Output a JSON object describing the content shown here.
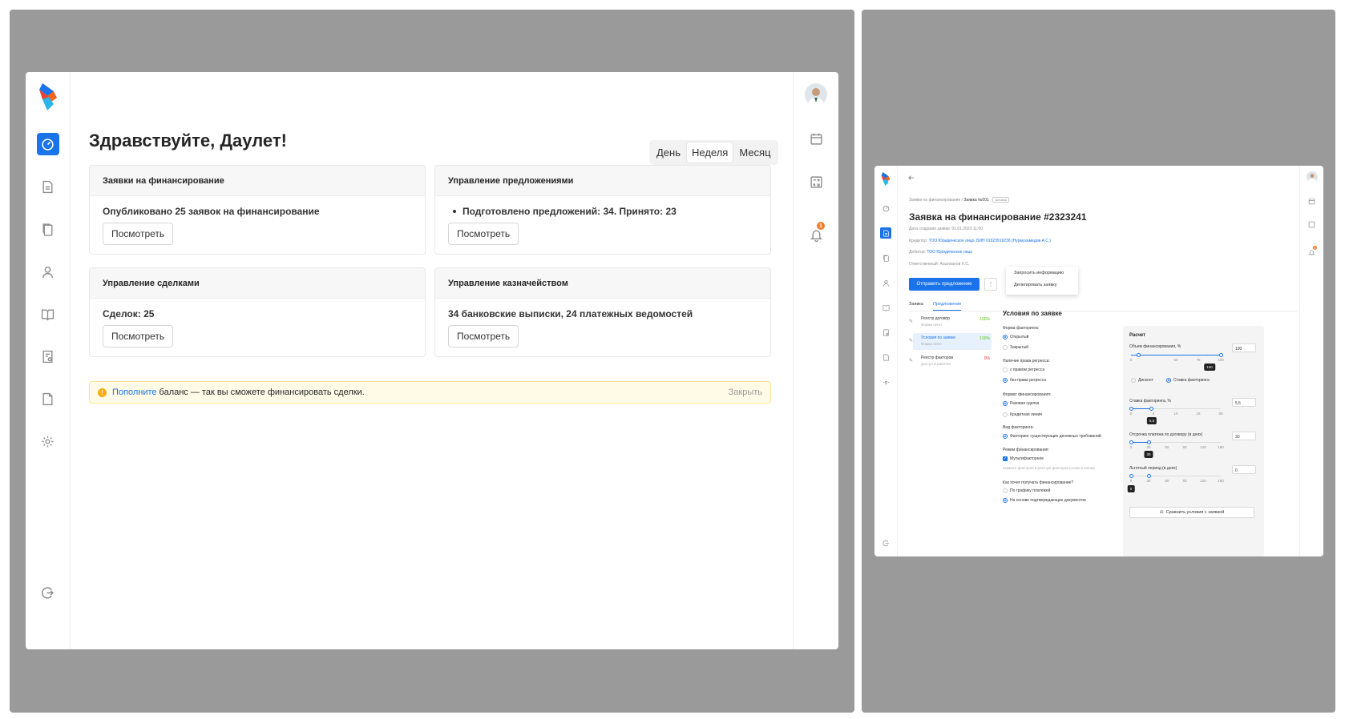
{
  "dashboard": {
    "greeting": "Здравствуйте, Даулет!",
    "period_tabs": [
      "День",
      "Неделя",
      "Месяц"
    ],
    "period_selected": "Неделя",
    "cards": [
      {
        "title": "Заявки на финансирование",
        "text": "Опубликовано 25 заявок на финансирование",
        "button": "Посмотреть"
      },
      {
        "title": "Управление предложениями",
        "text": "Подготовлено предложений: 34. Принято: 23",
        "button": "Посмотреть"
      },
      {
        "title": "Управление сделками",
        "text": "Сделок: 25",
        "button": "Посмотреть"
      },
      {
        "title": "Управление казначейством",
        "text": "34 банковские выписки, 24 платежных ведомостей",
        "button": "Посмотреть"
      }
    ],
    "alert": {
      "link": "Пополните",
      "text": "баланс — так вы сможете финансировать сделки.",
      "close": "Закрыть"
    },
    "notification_count": "1"
  },
  "application": {
    "breadcrumb": [
      "Заявки на финансирование",
      "Заявка №001"
    ],
    "status": "Активна",
    "title": "Заявка на финансирование #2323241",
    "created_label": "Дата создания заявки: 01.01.2023 11:00",
    "creditor_label": "Кредитор:",
    "creditor_value": "ТОО Юридическое лицо, БИН 01923919236 (Нурмухамедов А.С.)",
    "debtor_label": "Дебитор:",
    "debtor_value": "ТОО Юридическое лицо",
    "responsible": "Ответственный: Асылханов Х.С.",
    "send_button": "Отправить предложение",
    "more_button": "⋮",
    "menu": [
      "Запросить информацию",
      "Делегировать заявку"
    ],
    "tabs": [
      "Заявка",
      "Предложение"
    ],
    "tab_selected": "Предложение",
    "steps": [
      {
        "name": "Реестр договор",
        "sub": "Форма агент",
        "pct": "100%",
        "color": "#52c41a"
      },
      {
        "name": "Условия по заявке",
        "sub": "Форма агент",
        "pct": "100%",
        "color": "#52c41a"
      },
      {
        "name": "Реестр факторов",
        "sub": "Доступ ограничен",
        "pct": "0%",
        "color": "#f5222d"
      }
    ],
    "conditions_title": "Условия по заявке",
    "form_label": "Форма факторинга:",
    "form_options": [
      "Открытый",
      "Закрытый"
    ],
    "regress_label": "Наличие права регресса:",
    "regress_options": [
      "с правом регресса",
      "без права регресса"
    ],
    "format_label": "Формат финансирования:",
    "format_options": [
      "Разовая сделка",
      "Кредитная линия"
    ],
    "type_label": "Вид факторинга:",
    "type_options": [
      "Факторинг существующих денежных требований"
    ],
    "mode_label": "Режим финансирования:",
    "mode_options": [
      "Мультифакторное"
    ],
    "mode_hint": "Укажите факторов в реестре факторов (слева в меню)",
    "receive_label": "Как хочет получать финансирование?",
    "receive_options": [
      "По графику платежей",
      "На основе подтверждающих документов"
    ],
    "calc": {
      "title": "Расчет",
      "volume_label": "Объем финансирования, %",
      "volume_value": "100",
      "volume_ticks": [
        "0",
        "50",
        "75",
        "100"
      ],
      "volume_level": 100,
      "discount_options": [
        "Дисконт",
        "Ставка факторинга"
      ],
      "rate_label": "Ставка факторинга, %",
      "rate_value": "5,5",
      "rate_ticks": [
        "0",
        "5",
        "10",
        "15",
        "50"
      ],
      "rate_tip": "5,5",
      "delay_label": "Отсрочка платежа по договору (в днях)",
      "delay_value": "30",
      "delay_ticks": [
        "0",
        "30",
        "60",
        "90",
        "120",
        "180"
      ],
      "delay_tip": "30",
      "grace_label": "Льготный период (в днях)",
      "grace_value": "0",
      "grace_ticks": [
        "0",
        "30",
        "60",
        "90",
        "120",
        "180"
      ],
      "grace_tip": "0",
      "compare_button": "Сравнить условия с заявкой"
    }
  }
}
